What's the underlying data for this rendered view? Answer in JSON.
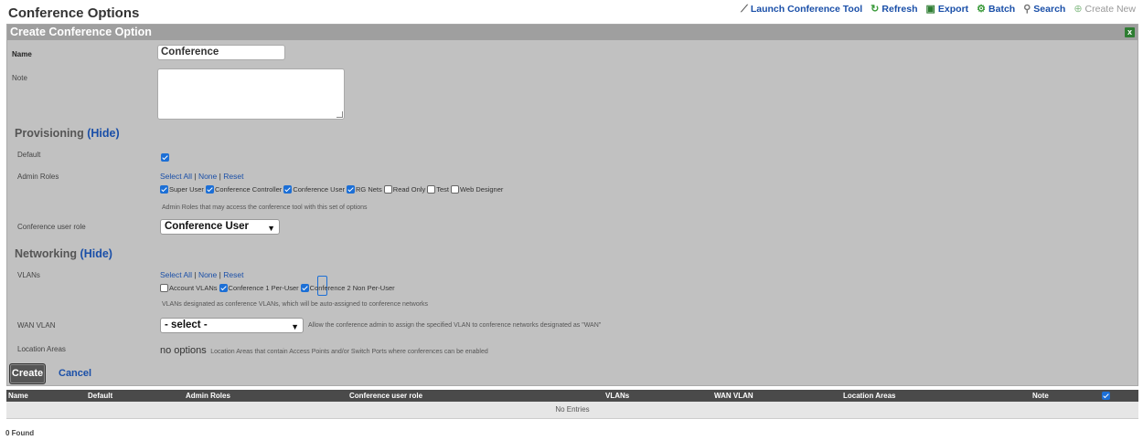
{
  "page": {
    "title": "Conference Options"
  },
  "toolbar": {
    "launch": "Launch Conference Tool",
    "refresh": "Refresh",
    "export": "Export",
    "batch": "Batch",
    "search": "Search",
    "create_new": "Create New"
  },
  "panel": {
    "title": "Create Conference Option",
    "close": "x",
    "name_label": "Name",
    "name_value": "Conference",
    "note_label": "Note",
    "note_value": ""
  },
  "provisioning": {
    "heading": "Provisioning",
    "toggle": "(Hide)",
    "default_label": "Default",
    "default_checked": true,
    "admin_roles_label": "Admin Roles",
    "select_all": "Select All",
    "sep1": "|",
    "none": "None",
    "sep2": "|",
    "reset": "Reset",
    "roles": [
      {
        "label": "Super User",
        "checked": true
      },
      {
        "label": "Conference Controller",
        "checked": true
      },
      {
        "label": "Conference User",
        "checked": true
      },
      {
        "label": "RG Nets",
        "checked": true
      },
      {
        "label": "Read Only",
        "checked": false
      },
      {
        "label": "Test",
        "checked": false
      },
      {
        "label": "Web Designer",
        "checked": false
      }
    ],
    "roles_help": "Admin Roles that may access the conference tool with this set of options",
    "user_role_label": "Conference user role",
    "user_role_value": "Conference User"
  },
  "networking": {
    "heading": "Networking",
    "toggle": "(Hide)",
    "vlans_label": "VLANs",
    "select_all": "Select All",
    "sep1": "|",
    "none": "None",
    "sep2": "|",
    "reset": "Reset",
    "vlans": [
      {
        "label": "Account VLANs",
        "checked": false
      },
      {
        "label": "Conference 1 Per-User",
        "checked": true
      },
      {
        "label": "Conference 2 Non Per-User",
        "checked": true
      }
    ],
    "vlans_help": "VLANs designated as conference VLANs, which will be auto-assigned to conference networks",
    "wan_label": "WAN VLAN",
    "wan_value": "- select -",
    "wan_help": "Allow the conference admin to assign the specified VLAN to conference networks designated as \"WAN\"",
    "location_label": "Location Areas",
    "location_value": "no options",
    "location_help": "Location Areas that contain Access Points and/or Switch Ports where conferences can be enabled"
  },
  "actions": {
    "create": "Create",
    "cancel": "Cancel"
  },
  "table": {
    "columns": [
      "Name",
      "Default",
      "Admin Roles",
      "Conference user role",
      "VLANs",
      "WAN VLAN",
      "Location Areas",
      "Note"
    ],
    "empty": "No Entries",
    "found": "0 Found"
  }
}
